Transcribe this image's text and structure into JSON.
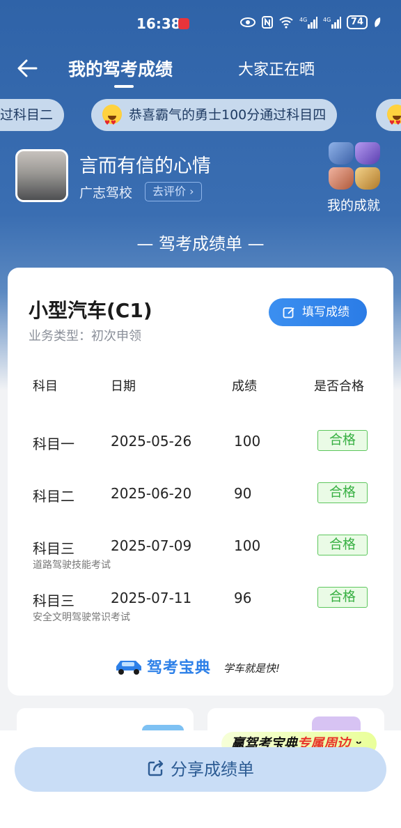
{
  "status_bar": {
    "time": "16:38",
    "battery": "74"
  },
  "header": {
    "tab_active": "我的驾考成绩",
    "tab_other": "大家正在晒"
  },
  "ticker": {
    "items": [
      {
        "text": "过科目二",
        "emoji": "star-struck"
      },
      {
        "text": "恭喜霸气的勇士100分通过科目四",
        "emoji": "star-struck"
      },
      {
        "text": "",
        "emoji": "star-struck"
      }
    ]
  },
  "profile": {
    "name": "言而有信的心情",
    "school": "广志驾校",
    "rate_label": "去评价",
    "achievements_label": "我的成就"
  },
  "section_title": "— 驾考成绩单 —",
  "card": {
    "vehicle": "小型汽车(C1)",
    "business_type": "业务类型：初次申领",
    "fill_button": "填写成绩",
    "columns": [
      "科目",
      "日期",
      "成绩",
      "是否合格"
    ],
    "rows": [
      {
        "subject": "科目一",
        "date": "2025-05-26",
        "score": "100",
        "result": "合格",
        "sub": ""
      },
      {
        "subject": "科目二",
        "date": "2025-06-20",
        "score": "90",
        "result": "合格",
        "sub": ""
      },
      {
        "subject": "科目三",
        "date": "2025-07-09",
        "score": "100",
        "result": "合格",
        "sub": "道路驾驶技能考试"
      },
      {
        "subject": "科目三",
        "date": "2025-07-11",
        "score": "96",
        "result": "合格",
        "sub": "安全文明驾驶常识考试"
      }
    ],
    "brand_name": "驾考宝典",
    "brand_slogan": "学车就是快!"
  },
  "promo": {
    "text_a": "赢驾考宝典",
    "text_b": "专属周边"
  },
  "share_button": "分享成绩单",
  "colors": {
    "header_blue": "#2f63a8",
    "button_blue": "#2b7ce6",
    "pass_green": "#38b043"
  }
}
